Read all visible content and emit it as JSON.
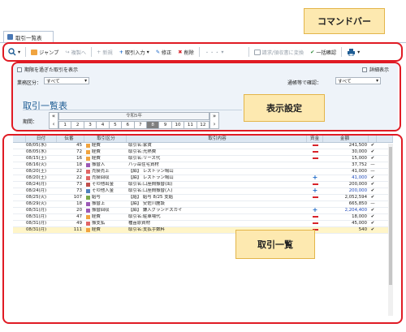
{
  "tab": {
    "title": "取引一覧表"
  },
  "toolbar": {
    "jump": "ジャンプ",
    "copy": "複製へ",
    "new": "新規",
    "input": "取引入力",
    "edit": "修正",
    "delete": "削除",
    "more": "・・・",
    "request": "請求/領収書に変換",
    "confirm": "一括確認"
  },
  "filter": {
    "show_expired": "期限を過ぎた取引を表示",
    "detail": "詳細表示",
    "account_label": "業務区分：",
    "account_value": "すべて",
    "notice_label": "通帳等で確認：",
    "notice_value": "すべて",
    "title": "取引一覧表",
    "period_label": "期間：",
    "year": "令和5年",
    "months": [
      "1",
      "2",
      "3",
      "4",
      "5",
      "6",
      "7",
      "8",
      "9",
      "10",
      "11",
      "12"
    ],
    "selected_month": "8"
  },
  "table": {
    "headers": [
      "日付",
      "伝番",
      "取引区分",
      "取引内容",
      "資金",
      "金額"
    ],
    "rows": [
      {
        "date": "08/05(水)",
        "no": "45",
        "cat": "経費",
        "cat_color": "#f0a440",
        "content": "取引名:家賃",
        "fund": "minus",
        "amount": "241,500",
        "ck": "✔",
        "hl": false
      },
      {
        "date": "08/05(水)",
        "no": "72",
        "cat": "経費",
        "cat_color": "#f0a440",
        "content": "取引名:光熱費",
        "fund": "minus",
        "amount": "30,000",
        "ck": "✔",
        "hl": false
      },
      {
        "date": "08/15(土)",
        "no": "16",
        "cat": "経費",
        "cat_color": "#f0a440",
        "content": "取引名:リース代",
        "fund": "minus",
        "amount": "15,000",
        "ck": "✔",
        "hl": false
      },
      {
        "date": "08/16(火)",
        "no": "18",
        "cat": "振替入",
        "cat_color": "#9b59b6",
        "content": "ハッ岳住宅資材",
        "fund": "",
        "amount": "37,752",
        "ck": "—",
        "hl": false
      },
      {
        "date": "08/20(土)",
        "no": "22",
        "cat": "売掛売上",
        "cat_color": "#e06666",
        "content": "【締】 レストラン鳩山",
        "fund": "",
        "amount": "41,000",
        "ck": "—",
        "hl": false
      },
      {
        "date": "08/20(土)",
        "no": "22",
        "cat": "売掛回収",
        "cat_color": "#e06666",
        "content": "【締】 レストラン鳩山",
        "fund": "plus",
        "amount": "41,000",
        "ck": "✔",
        "hl": false
      },
      {
        "date": "08/24(月)",
        "no": "73",
        "cat": "その他出金",
        "cat_color": "#c0504d",
        "content": "取引名:口座間振替(出)",
        "fund": "minus",
        "amount": "200,000",
        "ck": "✔",
        "hl": false
      },
      {
        "date": "08/24(月)",
        "no": "73",
        "cat": "その他入金",
        "cat_color": "#4f81bd",
        "content": "取引名:口座間振替(入)",
        "fund": "plus",
        "amount": "200,000",
        "ck": "✔",
        "hl": false
      },
      {
        "date": "08/25(火)",
        "no": "107",
        "cat": "給与",
        "cat_color": "#7aa84b",
        "content": "【給】 給与 8/25 支給",
        "fund": "minus",
        "amount": "2,052,594",
        "ck": "✔",
        "hl": false
      },
      {
        "date": "08/29(火)",
        "no": "18",
        "cat": "振替上",
        "cat_color": "#9b59b6",
        "content": "【締】 安佐川施設",
        "fund": "",
        "amount": "665,850",
        "ck": "—",
        "hl": false
      },
      {
        "date": "08/31(月)",
        "no": "20",
        "cat": "振替回収",
        "cat_color": "#9b59b6",
        "content": "【締】 鎌入グランドスカイ",
        "fund": "plus",
        "amount": "2,204,400",
        "ck": "✔",
        "hl": false
      },
      {
        "date": "08/31(月)",
        "no": "47",
        "cat": "経費",
        "cat_color": "#f0a440",
        "content": "取引名:駐車場代",
        "fund": "minus",
        "amount": "18,000",
        "ck": "✔",
        "hl": false
      },
      {
        "date": "08/31(月)",
        "no": "49",
        "cat": "振支払",
        "cat_color": "#e06666",
        "content": "種苗原資材",
        "fund": "minus",
        "amount": "45,000",
        "ck": "✔",
        "hl": false
      },
      {
        "date": "08/31(月)",
        "no": "111",
        "cat": "経費",
        "cat_color": "#f0a440",
        "content": "取引名:支払手数料",
        "fund": "minus",
        "amount": "540",
        "ck": "✔",
        "hl": true
      }
    ]
  },
  "callouts": {
    "command": "コマンドバー",
    "display": "表示設定",
    "list": "取引一覧"
  }
}
